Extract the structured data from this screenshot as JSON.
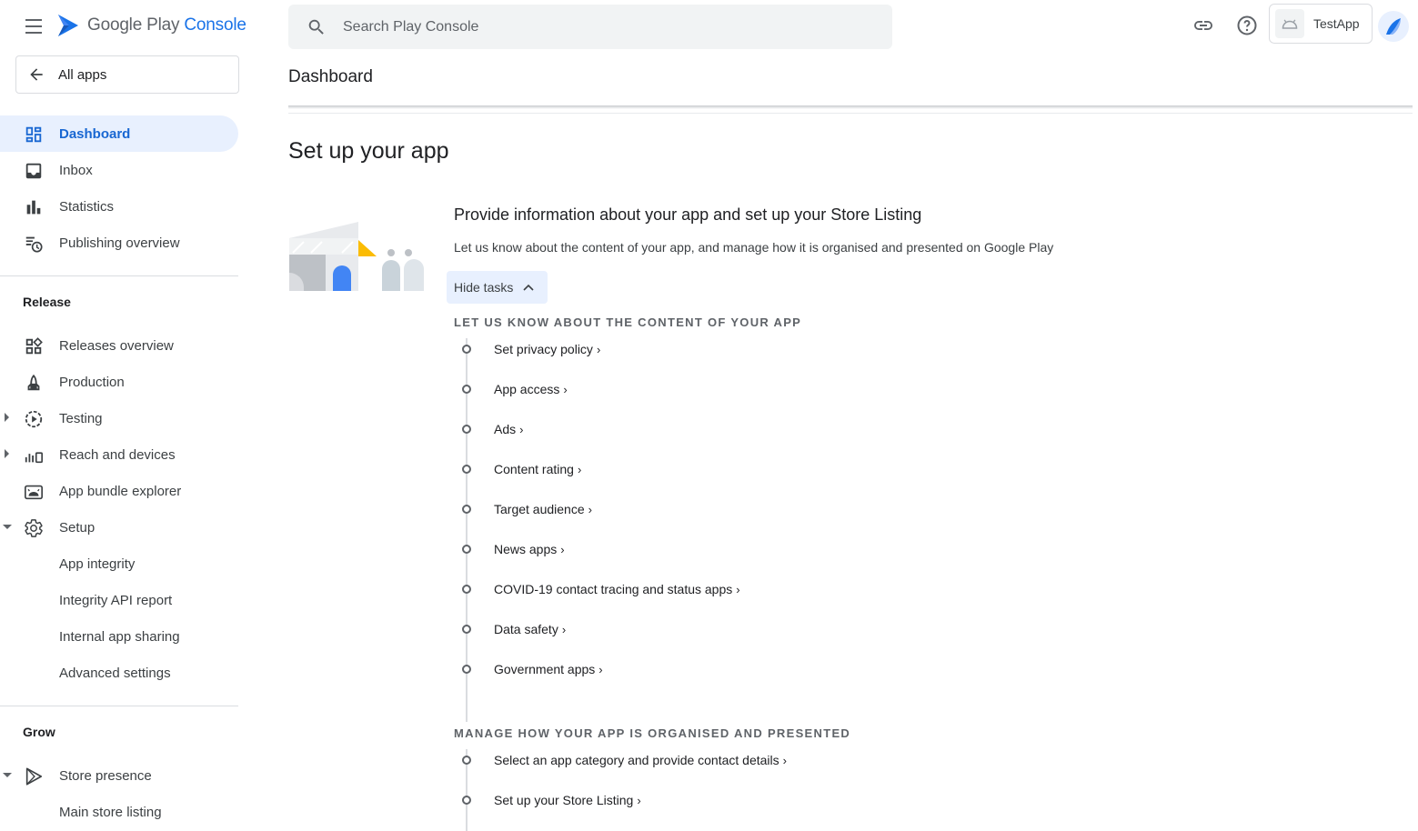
{
  "brand": {
    "name_prefix": "Google Play",
    "name_suffix": "Console"
  },
  "sidebar": {
    "all_apps_label": "All apps",
    "items": [
      {
        "label": "Dashboard",
        "icon": "dashboard-icon",
        "active": true
      },
      {
        "label": "Inbox",
        "icon": "inbox-icon"
      },
      {
        "label": "Statistics",
        "icon": "bar-chart-icon"
      },
      {
        "label": "Publishing overview",
        "icon": "publishing-overview-icon"
      }
    ],
    "release_section": "Release",
    "release_items": [
      {
        "label": "Releases overview",
        "icon": "releases-overview-icon"
      },
      {
        "label": "Production",
        "icon": "production-icon"
      },
      {
        "label": "Testing",
        "icon": "testing-icon"
      },
      {
        "label": "Reach and devices",
        "icon": "reach-devices-icon"
      },
      {
        "label": "App bundle explorer",
        "icon": "android-icon"
      },
      {
        "label": "Setup",
        "icon": "gear-icon"
      }
    ],
    "setup_sub_items": [
      {
        "label": "App integrity"
      },
      {
        "label": "Integrity API report"
      },
      {
        "label": "Internal app sharing"
      },
      {
        "label": "Advanced settings"
      }
    ],
    "grow_section": "Grow",
    "grow_items": [
      {
        "label": "Store presence",
        "icon": "play-icon"
      },
      {
        "label": "Main store listing"
      }
    ]
  },
  "topbar": {
    "search_placeholder": "Search Play Console",
    "app_name": "TestApp"
  },
  "page": {
    "title": "Dashboard",
    "setup_title": "Set up your app",
    "card_title": "Provide information about your app and set up your Store Listing",
    "card_desc": "Let us know about the content of your app, and manage how it is organised and presented on Google Play",
    "hide_tasks_label": "Hide tasks"
  },
  "groups": {
    "content": {
      "label": "LET US KNOW ABOUT THE CONTENT OF YOUR APP",
      "tasks": [
        "Set privacy policy",
        "App access",
        "Ads",
        "Content rating",
        "Target audience",
        "News apps",
        "COVID-19 contact tracing and status apps",
        "Data safety",
        "Government apps"
      ]
    },
    "presentation": {
      "label": "MANAGE HOW YOUR APP IS ORGANISED AND PRESENTED",
      "tasks": [
        "Select an app category and provide contact details",
        "Set up your Store Listing"
      ]
    }
  },
  "colors": {
    "accent": "#1a73e8",
    "active_bg": "#e8f0fe",
    "text": "#202124",
    "muted": "#5f6368"
  }
}
